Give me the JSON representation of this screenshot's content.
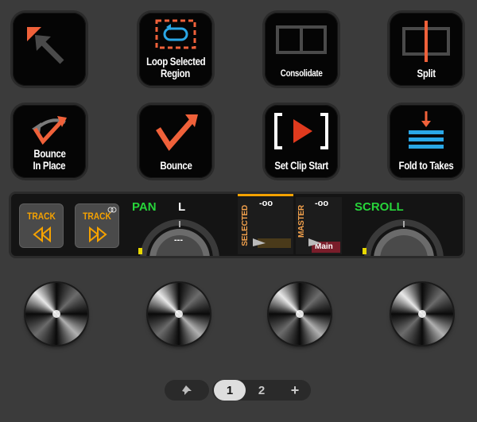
{
  "pads": {
    "row1": [
      {
        "label": "",
        "icon": "arrow-up-left-icon"
      },
      {
        "label": "Loop Selected Region",
        "line1": "Loop Selected",
        "line2": "Region",
        "icon": "loop-region-icon"
      },
      {
        "label": "Consolidate",
        "icon": "consolidate-icon"
      },
      {
        "label": "Split",
        "icon": "split-icon"
      }
    ],
    "row2": [
      {
        "line1": "Bounce",
        "line2": "In Place",
        "icon": "bounce-in-place-icon"
      },
      {
        "label": "Bounce",
        "icon": "bounce-icon"
      },
      {
        "label": "Set Clip Start",
        "icon": "set-clip-start-icon"
      },
      {
        "label": "Fold to Takes",
        "icon": "fold-to-takes-icon"
      }
    ]
  },
  "strip": {
    "track_prev_label": "TRACK",
    "track_next_label": "TRACK",
    "pan_label": "PAN",
    "pan_value_label": "L",
    "pan_knob_value": "---",
    "selected_label": "SELECTED",
    "selected_value": "-oo",
    "master_label": "MASTER",
    "master_value": "-oo",
    "master_output": "Main",
    "scroll_label": "SCROLL"
  },
  "pager": {
    "page1": "1",
    "page2": "2",
    "add": "+"
  },
  "colors": {
    "accent_orange": "#f0613a",
    "track_orange": "#f5a200",
    "green": "#27d43a",
    "blue": "#2aa7e6",
    "red": "#e03a1e"
  }
}
